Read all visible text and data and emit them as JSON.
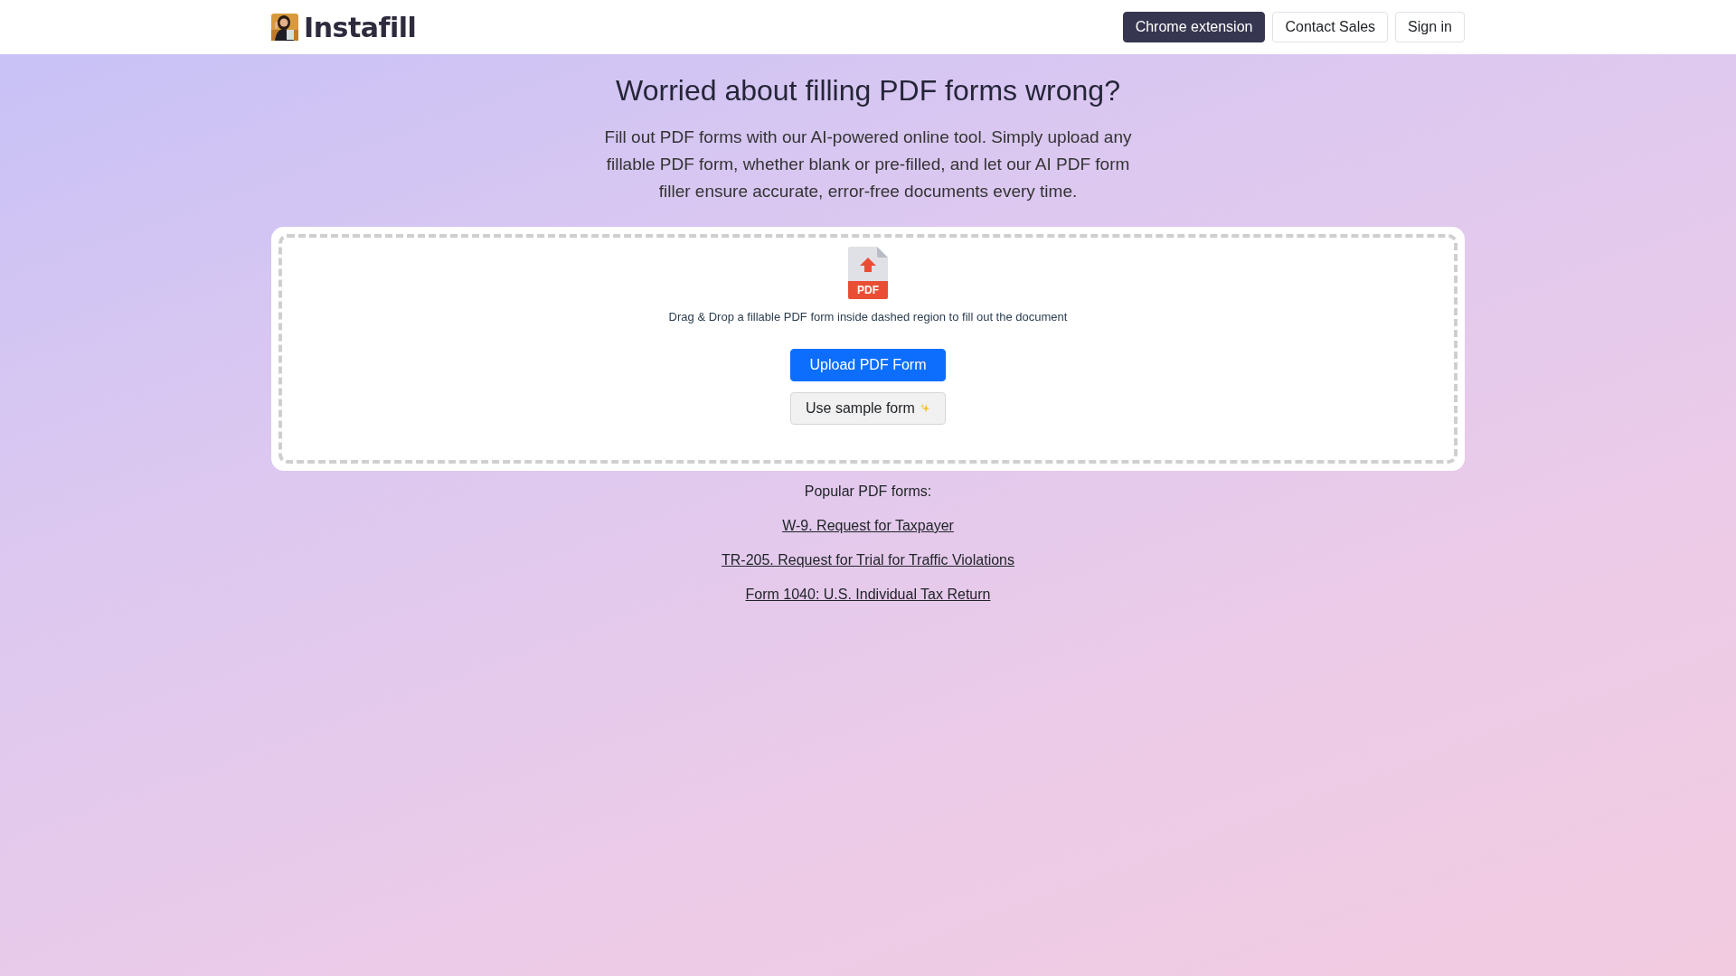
{
  "header": {
    "logo": {
      "kind": "picture",
      "text": "Instafill"
    },
    "buttons": [
      {
        "label": "Chrome extension",
        "kind": "primary"
      },
      {
        "label": "Contact Sales",
        "kind": "outline"
      },
      {
        "label": "Sign in",
        "kind": "outline"
      }
    ]
  },
  "hero": {
    "title": "Worried about filling PDF forms wrong?",
    "description": "Fill out PDF forms with our AI-powered online tool. Simply upload any fillable PDF form, whether blank or pre-filled, and let our AI PDF form filler ensure accurate, error-free documents every time."
  },
  "dropzone": {
    "icon_label": "PDF",
    "hint": "Drag & Drop a fillable PDF form inside dashed region to fill out the document",
    "buttons": [
      {
        "label": "Upload PDF Form",
        "kind": "primary"
      },
      {
        "label": "Use sample form",
        "kind": "sample"
      }
    ]
  },
  "popular": {
    "heading": "Popular PDF forms:",
    "links": [
      "W-9. Request for Taxpayer",
      "TR-205. Request for Trial for Traffic Violations",
      "Form 1040: U.S. Individual Tax Return"
    ]
  }
}
